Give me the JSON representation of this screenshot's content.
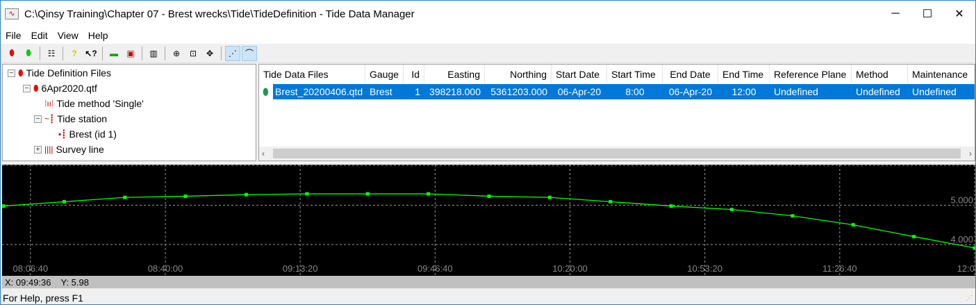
{
  "window": {
    "title": "C:\\Qinsy Training\\Chapter 07 - Brest wrecks\\Tide\\TideDefinition - Tide Data Manager",
    "minimize": "─",
    "maximize": "☐",
    "close": "✕"
  },
  "menu": [
    "File",
    "Edit",
    "View",
    "Help"
  ],
  "tree": {
    "root": "Tide Definition Files",
    "file": "6Apr2020.qtf",
    "method": "Tide method 'Single'",
    "station": "Tide station",
    "gauge": "Brest (id 1)",
    "survey": "Survey line"
  },
  "table": {
    "headers": [
      "Tide Data Files",
      "Gauge",
      "Id",
      "Easting",
      "Northing",
      "Start Date",
      "Start Time",
      "End Date",
      "End Time",
      "Reference Plane",
      "Method",
      "Maintenance"
    ],
    "rows": [
      [
        "Brest_20200406.qtd",
        "Brest",
        "1",
        "398218.000",
        "5361203.000",
        "06-Apr-20",
        "8:00",
        "06-Apr-20",
        "12:00",
        "Undefined",
        "Undefined",
        "Undefined"
      ]
    ]
  },
  "coords": {
    "x": "X: 09:49:36",
    "y": "Y:  5.98"
  },
  "status": "For Help, press F1",
  "chart_data": {
    "type": "line",
    "title": "",
    "xlabel": "",
    "ylabel": "",
    "x_seconds_from_0800": [
      0,
      900,
      1800,
      2700,
      3600,
      4500,
      5400,
      6300,
      7200,
      8100,
      9000,
      9900,
      10800,
      11700,
      12600,
      13500,
      14400
    ],
    "values": [
      4.98,
      5.09,
      5.2,
      5.23,
      5.27,
      5.29,
      5.29,
      5.29,
      5.23,
      5.2,
      5.09,
      4.98,
      4.89,
      4.73,
      4.5,
      4.2,
      3.91
    ],
    "xticks": [
      "08:06:40",
      "08:40:00",
      "09:13:20",
      "09:46:40",
      "10:20:00",
      "10:53:20",
      "11:26:40",
      "12:0"
    ],
    "xtick_seconds": [
      400,
      2400,
      4400,
      6400,
      8400,
      10400,
      12400,
      14400
    ],
    "yticks": [
      "5.000",
      "4.000"
    ],
    "ytick_values": [
      5,
      4
    ],
    "xlim": [
      0,
      14400
    ],
    "ylim": [
      3.2,
      6.0
    ],
    "grid": true,
    "color": "#00ff00"
  }
}
